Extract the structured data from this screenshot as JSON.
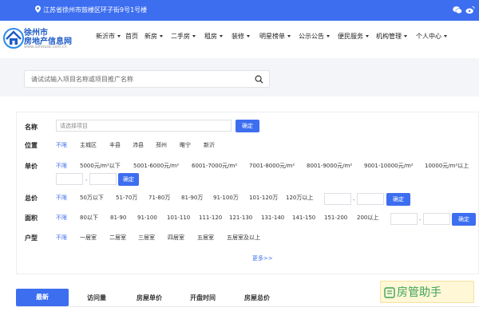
{
  "topbar": {
    "address": "江苏省徐州市鼓楼区环子街9号1号楼",
    "icons": [
      "location-icon",
      "wechat-icon",
      "weibo-icon"
    ]
  },
  "logo": {
    "line1": "徐州市",
    "line2": "房地产信息网",
    "url": "www.xzhouse.com.cn"
  },
  "nav": {
    "city": "新沂市",
    "items": [
      {
        "label": "首页",
        "dropdown": false
      },
      {
        "label": "新房",
        "dropdown": true
      },
      {
        "label": "二手房",
        "dropdown": true
      },
      {
        "label": "租房",
        "dropdown": true
      },
      {
        "label": "装修",
        "dropdown": true
      },
      {
        "label": "明星榜单",
        "dropdown": true
      },
      {
        "label": "公示公告",
        "dropdown": true
      },
      {
        "label": "便民服务",
        "dropdown": true
      },
      {
        "label": "机构管理",
        "dropdown": true
      },
      {
        "label": "个人中心",
        "dropdown": true
      }
    ]
  },
  "search": {
    "placeholder": "请试试输入项目名称或项目推广名称",
    "value": ""
  },
  "filters": {
    "name": {
      "label": "名称",
      "placeholder": "请选择项目",
      "confirm": "确定"
    },
    "location": {
      "label": "位置",
      "options": [
        "不限",
        "主城区",
        "丰县",
        "沛县",
        "邳州",
        "睢宁",
        "新沂"
      ],
      "selected": "不限"
    },
    "unit_price": {
      "label": "单价",
      "options": [
        "不限",
        "5000元/m²以下",
        "5001-6000元/m²",
        "6001-7000元/m²",
        "7001-8000元/m²",
        "8001-9000元/m²",
        "9001-10000元/m²",
        "10000元/m²以上"
      ],
      "selected": "不限",
      "range_sep": "-",
      "confirm": "确定"
    },
    "total_price": {
      "label": "总价",
      "options": [
        "不限",
        "50万以下",
        "51-70万",
        "71-80万",
        "81-90万",
        "91-100万",
        "101-120万",
        "120万以上"
      ],
      "selected": "不限",
      "range_sep": "-",
      "confirm": "确定"
    },
    "area": {
      "label": "面积",
      "options": [
        "不限",
        "80以下",
        "81-90",
        "91-100",
        "101-110",
        "111-120",
        "121-130",
        "131-140",
        "141-150",
        "151-200",
        "200以上"
      ],
      "selected": "不限",
      "range_sep": "-",
      "confirm": "确定"
    },
    "layout": {
      "label": "户型",
      "options": [
        "不限",
        "一居室",
        "二居室",
        "三居室",
        "四居室",
        "五居室",
        "五居室及以上"
      ],
      "selected": "不限"
    },
    "more": "更多>>"
  },
  "tabs": [
    {
      "label": "最新",
      "active": true
    },
    {
      "label": "访问量",
      "active": false
    },
    {
      "label": "房屋单价",
      "active": false
    },
    {
      "label": "开盘时间",
      "active": false
    },
    {
      "label": "房屋总价",
      "active": false
    }
  ],
  "watermark": {
    "text": "房管助手"
  },
  "colors": {
    "accent": "#3d6ef0",
    "badge_text": "#3aa35a"
  }
}
